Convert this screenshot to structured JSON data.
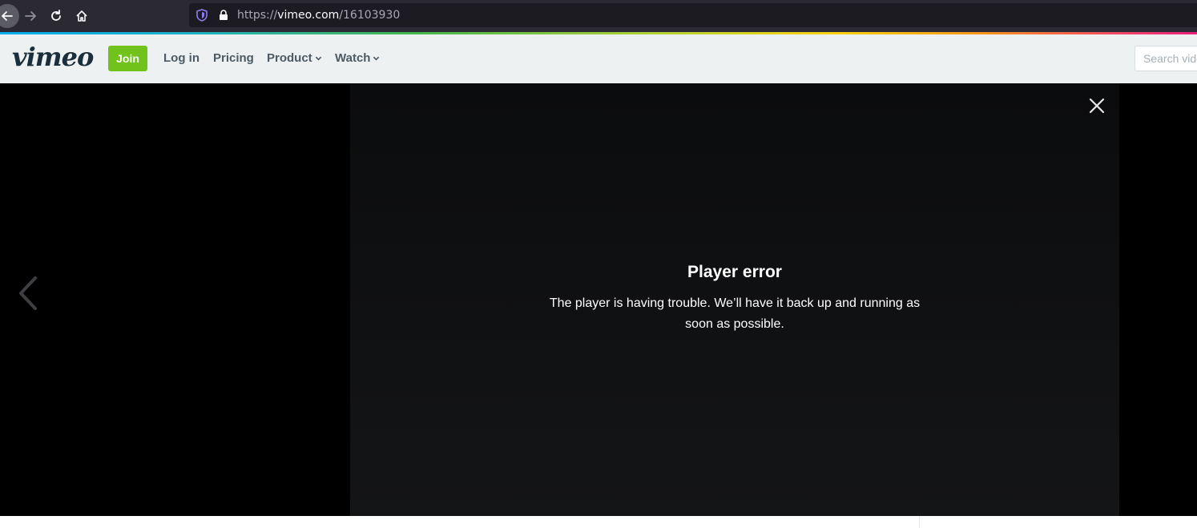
{
  "browser": {
    "url_scheme": "https://",
    "url_host": "vimeo.com",
    "url_path": "/16103930",
    "icons": {
      "back": "arrow-left-icon",
      "forward": "arrow-right-icon",
      "reload": "reload-icon",
      "home": "home-icon",
      "tracking": "shield-icon",
      "secure": "lock-icon"
    }
  },
  "header": {
    "logo": "vimeo",
    "join_label": "Join",
    "nav": {
      "login": "Log in",
      "pricing": "Pricing",
      "product": "Product",
      "watch": "Watch"
    },
    "search_placeholder": "Search videos"
  },
  "player": {
    "error_title": "Player error",
    "error_message": "The player is having trouble. We’ll have it back up and running as soon as possible."
  },
  "colors": {
    "join_green": "#71c21b",
    "header_bg": "#eef1f2",
    "logo_navy": "#1a2e3b"
  }
}
